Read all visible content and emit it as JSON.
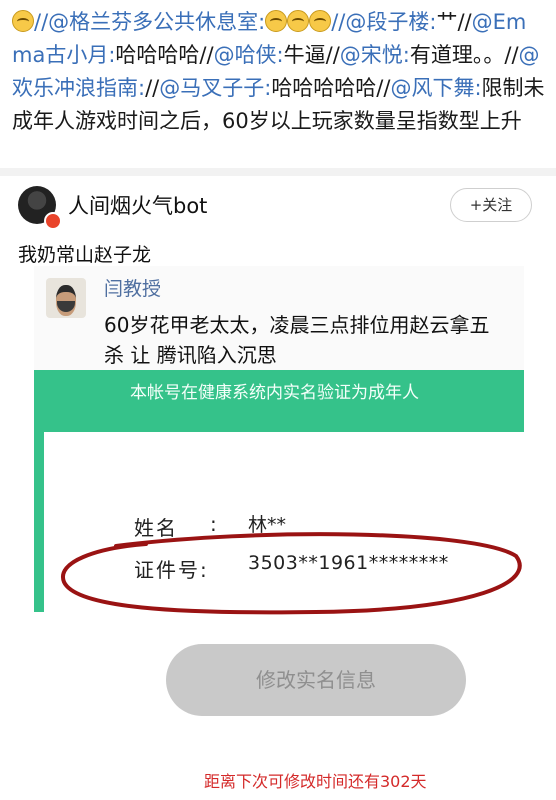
{
  "repost": {
    "m1": "//@格兰芬多公共休息室:",
    "m2": "//@段子楼:",
    "m2_text": "艹//",
    "m3": "@Emma古小月:",
    "m3_text": "哈哈哈哈//",
    "m4": "@哈侠:",
    "m4_text": "牛逼//",
    "m5": "@宋悦:",
    "m5_text": "有道理。。//",
    "m6": "@欢乐冲浪指南:",
    "m6_text": "//",
    "m7": "@马叉子子:",
    "m7_text": "哈哈哈哈哈//",
    "m8": "@风下舞:",
    "m8_text": "限制未成年人游戏时间之后，60岁以上玩家数量呈指数型上升"
  },
  "post": {
    "username": "人间烟火气bot",
    "follow_label": "+关注",
    "text": "我奶常山赵子龙"
  },
  "quote": {
    "author": "闫教授",
    "text": "60岁花甲老太太，凌晨三点排位用赵云拿五杀 让 腾讯陷入沉思"
  },
  "game_screen": {
    "banner": "本帐号在健康系统内实名验证为成年人",
    "name_label": "姓名",
    "colon": ":",
    "name_value": "林**",
    "id_label": "证件号:",
    "id_value": "3503**1961********",
    "modify_button": "修改实名信息",
    "notice": "距离下次可修改时间还有302天"
  },
  "watermark": "",
  "colors": {
    "mention": "#3a6fb8",
    "green": "#35c28a",
    "red": "#d42a2a"
  },
  "icons": [
    "laugh-emoji-icon",
    "avatar",
    "verified-badge-icon"
  ]
}
